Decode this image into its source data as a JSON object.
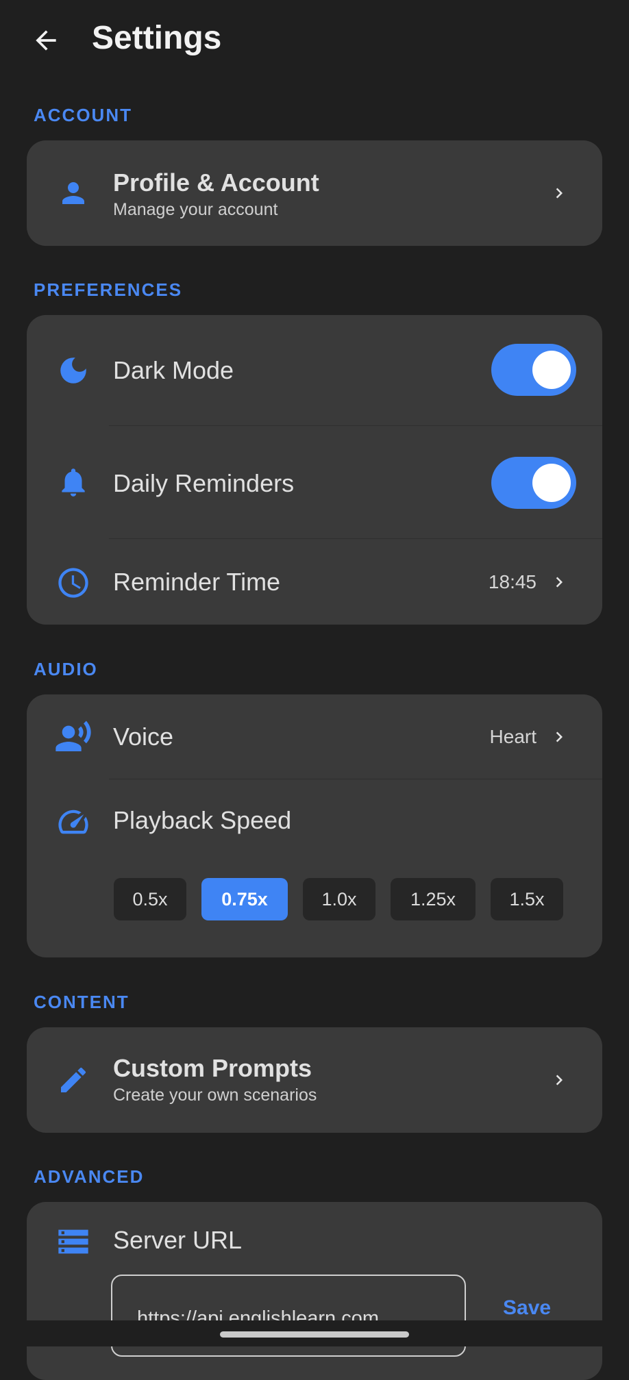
{
  "header": {
    "title": "Settings",
    "back_icon": "arrow-left-icon"
  },
  "colors": {
    "background": "#1f1f1f",
    "card": "#3a3a3a",
    "accent": "#3f84f4",
    "section_label": "#4a88f2"
  },
  "sections": {
    "account": {
      "label": "ACCOUNT",
      "profile": {
        "title": "Profile & Account",
        "subtitle": "Manage your account",
        "icon": "person-icon"
      }
    },
    "preferences": {
      "label": "PREFERENCES",
      "dark_mode": {
        "label": "Dark Mode",
        "enabled": true,
        "icon": "moon-icon"
      },
      "daily_reminders": {
        "label": "Daily Reminders",
        "enabled": true,
        "icon": "bell-icon"
      },
      "reminder_time": {
        "label": "Reminder Time",
        "value": "18:45",
        "icon": "clock-icon"
      }
    },
    "audio": {
      "label": "AUDIO",
      "voice": {
        "label": "Voice",
        "value": "Heart",
        "icon": "voice-icon"
      },
      "playback_speed": {
        "label": "Playback Speed",
        "icon": "speedometer-icon",
        "options": [
          "0.5x",
          "0.75x",
          "1.0x",
          "1.25x",
          "1.5x"
        ],
        "selected": "0.75x"
      }
    },
    "content": {
      "label": "CONTENT",
      "custom_prompts": {
        "title": "Custom Prompts",
        "subtitle": "Create your own scenarios",
        "icon": "pencil-icon"
      }
    },
    "advanced": {
      "label": "ADVANCED",
      "server_url": {
        "label": "Server URL",
        "value": "https://api.englishlearn.com",
        "save_label": "Save",
        "icon": "server-icon"
      }
    }
  }
}
